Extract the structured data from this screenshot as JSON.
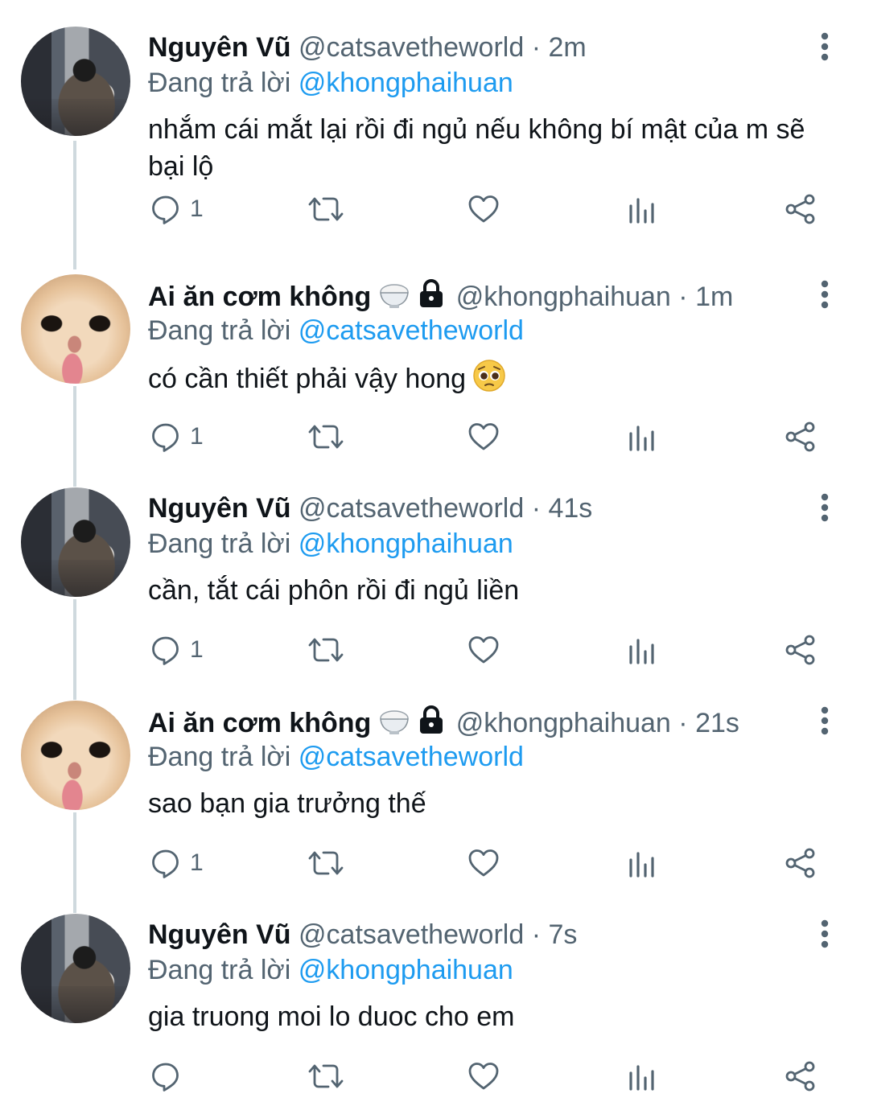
{
  "colors": {
    "link": "#1d9bf0",
    "muted": "#536471",
    "text": "#0f1419",
    "thread_line": "#cfd9de"
  },
  "icons": {
    "more": "more-vertical-icon",
    "reply": "reply-icon",
    "retweet": "retweet-icon",
    "like": "heart-icon",
    "analytics": "analytics-icon",
    "share": "share-icon"
  },
  "tweets": [
    {
      "name": "Nguyên Vũ",
      "handle": "@catsavetheworld",
      "time": "· 2m",
      "replying_label": "Đang trả lời",
      "replying_to": "@khongphaihuan",
      "text": "nhắm cái mắt lại rồi đi ngủ nếu không bí mật của m sẽ bại lộ",
      "reply_count": "1",
      "avatar": "person"
    },
    {
      "name": "Ai ăn cơm không",
      "handle": "@khongphaihuan",
      "time": "· 1m",
      "replying_label": "Đang trả lời",
      "replying_to": "@catsavetheworld",
      "text": "có cần thiết phải vậy hong",
      "reply_count": "1",
      "avatar": "cat"
    },
    {
      "name": "Nguyên Vũ",
      "handle": "@catsavetheworld",
      "time": "· 41s",
      "replying_label": "Đang trả lời",
      "replying_to": "@khongphaihuan",
      "text": "cần, tắt cái phôn rồi đi ngủ liền",
      "reply_count": "1",
      "avatar": "person"
    },
    {
      "name": "Ai ăn cơm không",
      "handle": "@khongphaihuan",
      "time": "· 21s",
      "replying_label": "Đang trả lời",
      "replying_to": "@catsavetheworld",
      "text": "sao bạn gia trưởng thế",
      "reply_count": "1",
      "avatar": "cat"
    },
    {
      "name": "Nguyên Vũ",
      "handle": "@catsavetheworld",
      "time": "· 7s",
      "replying_label": "Đang trả lời",
      "replying_to": "@khongphaihuan",
      "text": "gia truong moi lo duoc cho em",
      "reply_count": "",
      "avatar": "person"
    }
  ]
}
